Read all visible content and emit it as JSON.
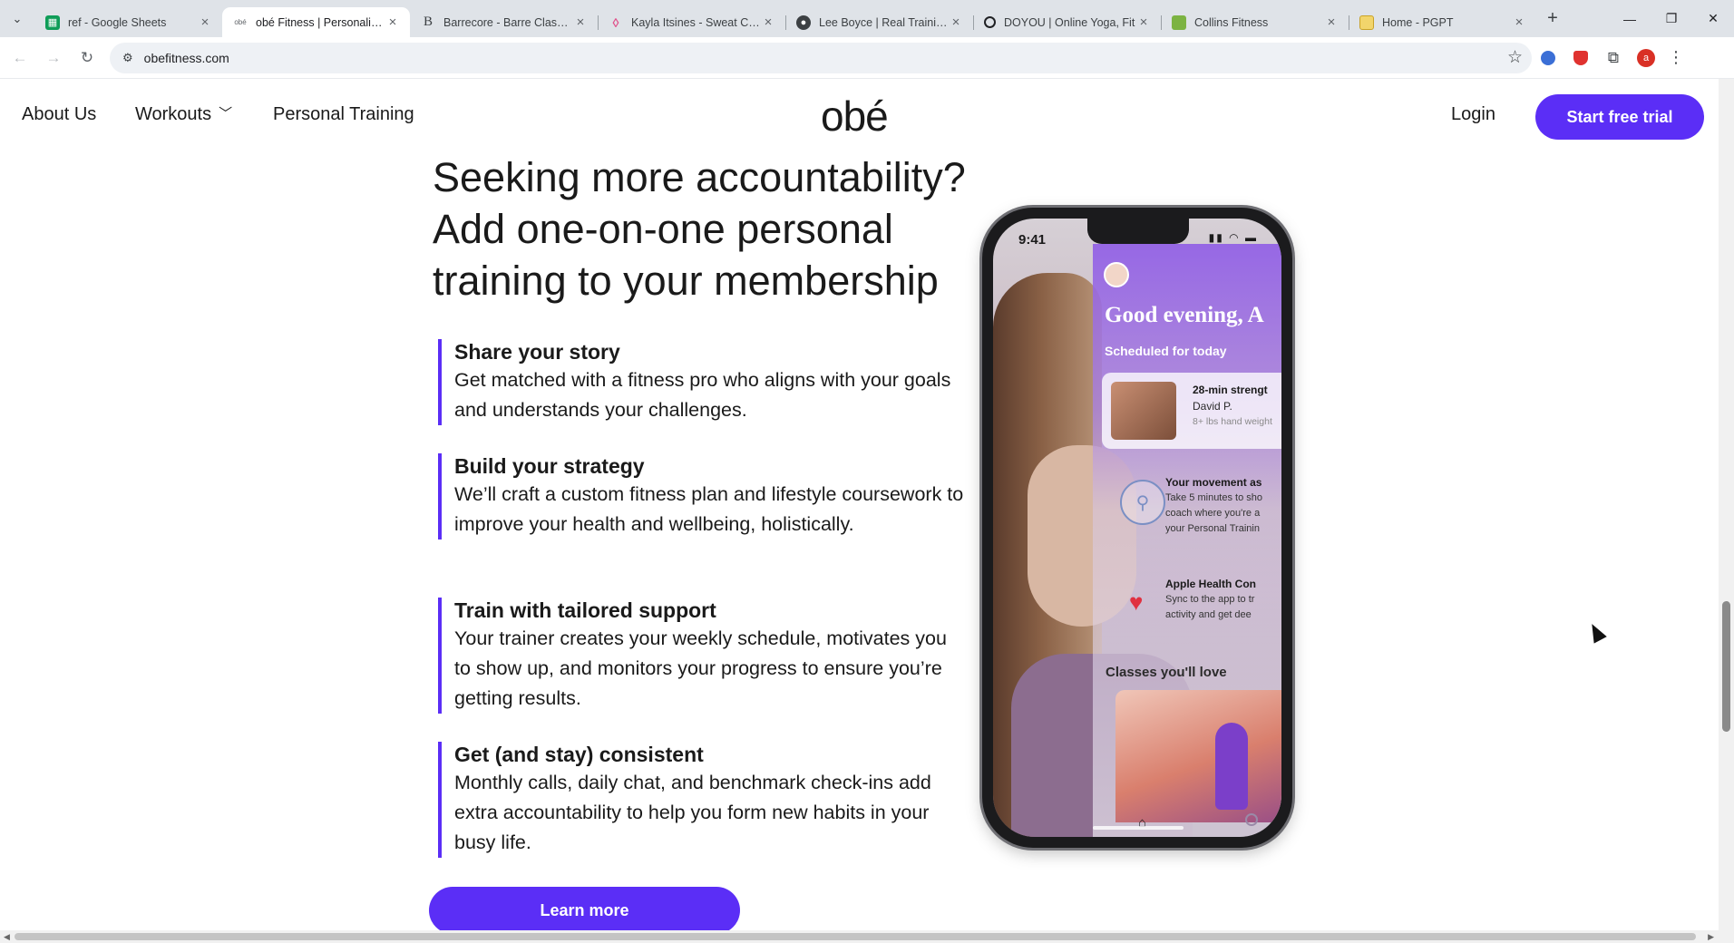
{
  "browser": {
    "tabs": [
      {
        "title": "ref - Google Sheets",
        "favicon": "sheets-icon",
        "color": "#0f9d58"
      },
      {
        "title": "obé Fitness | Personalized",
        "favicon": "obe-icon",
        "color": "#5f6368"
      },
      {
        "title": "Barrecore - Barre Classes",
        "favicon": "barrecore-icon",
        "color": "#3c4043"
      },
      {
        "title": "Kayla Itsines - Sweat Co-F",
        "favicon": "sweat-icon",
        "color": "#e0508a"
      },
      {
        "title": "Lee Boyce | Real Training,",
        "favicon": "lee-boyce-icon",
        "color": "#3c4043"
      },
      {
        "title": "DOYOU | Online Yoga, Fit",
        "favicon": "doyou-icon",
        "color": "#202124"
      },
      {
        "title": "Collins Fitness",
        "favicon": "collins-icon",
        "color": "#7cb342"
      },
      {
        "title": "Home - PGPT",
        "favicon": "pgpt-icon",
        "color": "#c9a227"
      }
    ],
    "url": "obefitness.com",
    "profile_initial": "a"
  },
  "site": {
    "nav": {
      "about": "About Us",
      "workouts": "Workouts",
      "personal_training": "Personal Training",
      "logo": "obé",
      "login": "Login",
      "cta": "Start free trial"
    },
    "headline": "Seeking more accountability? Add one-on-one personal training to your membership",
    "features": [
      {
        "title": "Share your story",
        "body": "Get matched with a fitness pro who aligns with your goals and understands your challenges."
      },
      {
        "title": "Build your strategy",
        "body": "We’ll craft a custom fitness plan and lifestyle coursework to improve your health and wellbeing, holistically."
      },
      {
        "title": "Train with tailored support",
        "body": "Your trainer creates your weekly schedule, motivates you to show up, and monitors your progress to ensure you’re getting results."
      },
      {
        "title": "Get (and stay) consistent",
        "body": "Monthly calls, daily chat, and benchmark check-ins add extra accountability to help you form new habits in your busy life."
      }
    ],
    "learn_more": "Learn more",
    "accent_color": "#5b2ef6"
  },
  "phone": {
    "time": "9:41",
    "greeting": "Good evening, A",
    "scheduled_label": "Scheduled for today",
    "class_title": "28-min strengt",
    "class_instructor": "David P.",
    "class_equipment": "8+ lbs hand weight",
    "movement_title": "Your movement as",
    "movement_line1": "Take 5 minutes to sho",
    "movement_line2": "coach where you're a",
    "movement_line3": "your Personal Trainin",
    "health_title": "Apple Health Con",
    "health_line1": "Sync to the app to tr",
    "health_line2": "activity and get dee",
    "classes_label": "Classes you'll love"
  }
}
